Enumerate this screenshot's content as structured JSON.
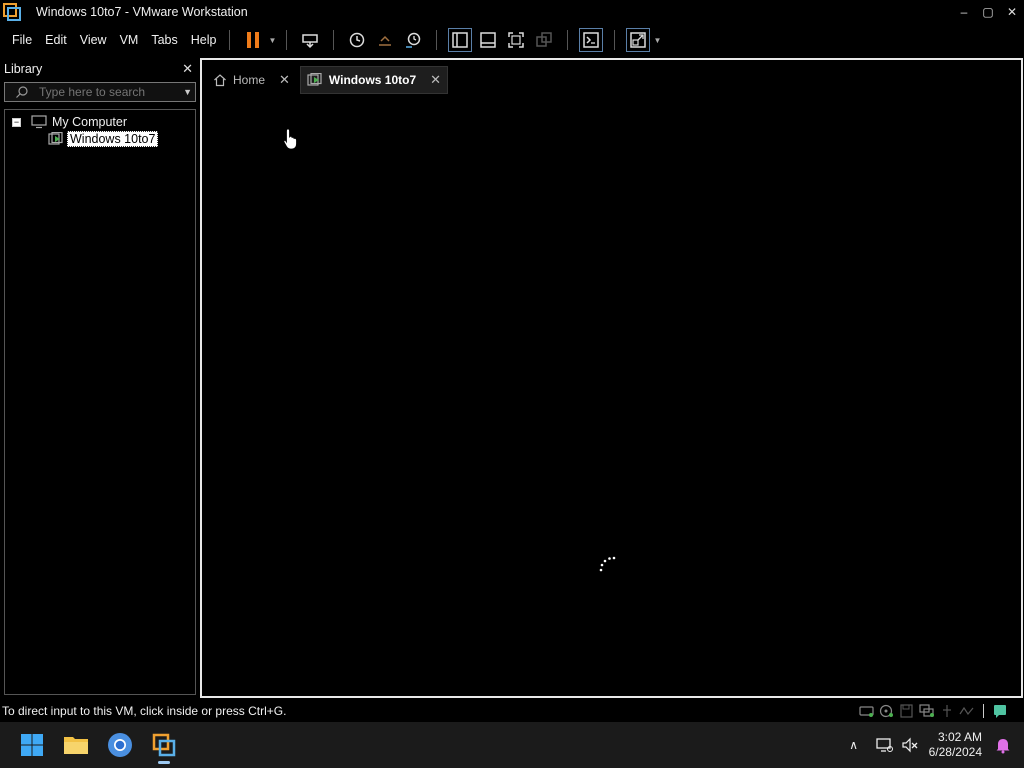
{
  "window": {
    "title": "Windows 10to7 - VMware Workstation",
    "minimize": "–",
    "maximize": "▢",
    "close": "✕"
  },
  "menu": {
    "file": "File",
    "edit": "Edit",
    "view": "View",
    "vm": "VM",
    "tabs": "Tabs",
    "help": "Help"
  },
  "colors": {
    "pause_orange": "#f07c1a",
    "tab_vm_green": "#4caf50",
    "accent_blue": "#1e88e5"
  },
  "library": {
    "title": "Library",
    "close": "✕",
    "search_placeholder": "Type here to search",
    "tree": {
      "root": "My Computer",
      "root_expander": "−",
      "child": "Windows 10to7"
    }
  },
  "tabs": [
    {
      "label": "Home",
      "close": "✕"
    },
    {
      "label": "Windows 10to7",
      "close": "✕"
    }
  ],
  "status": {
    "message": "To direct input to this VM, click inside or press Ctrl+G."
  },
  "taskbar": {
    "time": "3:02 AM",
    "date": "6/28/2024",
    "chevron": "∧"
  }
}
